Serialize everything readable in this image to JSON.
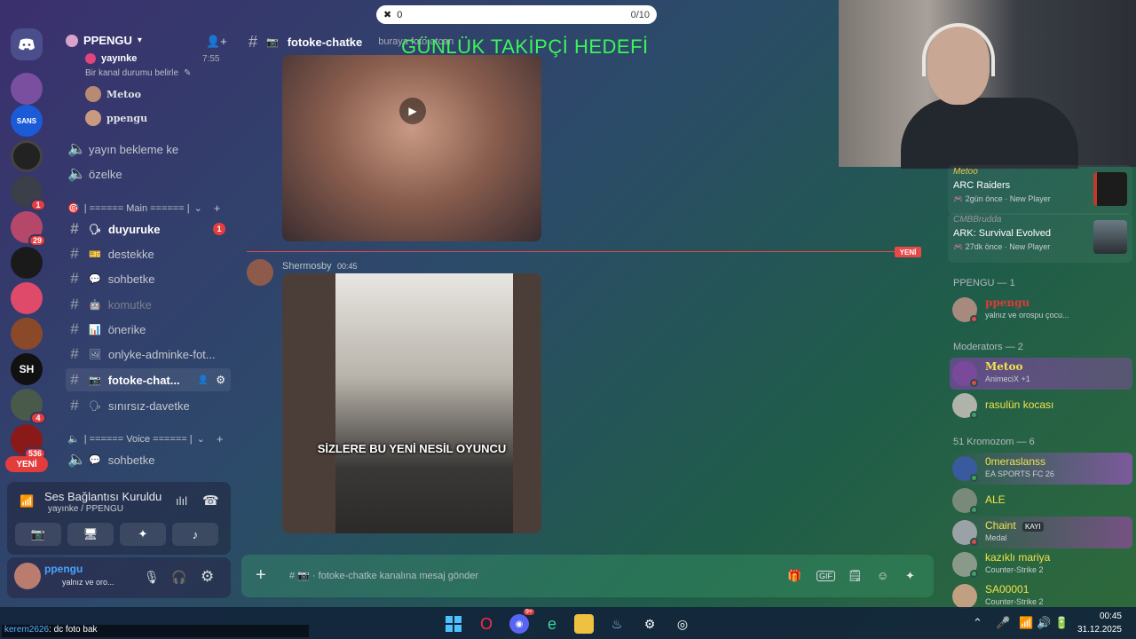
{
  "goal": {
    "current": "0",
    "count": "0/10",
    "title": "GÜNLÜK TAKİPÇİ HEDEFİ"
  },
  "server": {
    "name": "PPENGU"
  },
  "rail": {
    "badges": [
      "1",
      "29",
      "4",
      "536"
    ],
    "new_label": "YENİ"
  },
  "voice_top": {
    "user": "yayınke",
    "status": "Bir kanal durumu belirle",
    "time": "7:55",
    "members": [
      "Metoo",
      "ppengu"
    ]
  },
  "channels": {
    "voice_top": [
      "yayın bekleme ke",
      "özelke"
    ],
    "main_category": "| ====== Main ====== |",
    "text": [
      {
        "name": "duyuruke",
        "badge": "1"
      },
      {
        "name": "destekke"
      },
      {
        "name": "sohbetke"
      },
      {
        "name": "komutke"
      },
      {
        "name": "önerike"
      },
      {
        "name": "onlyke-adminke-fot..."
      },
      {
        "name": "fotoke-chat..."
      },
      {
        "name": "sınırsız-davetke"
      }
    ],
    "voice_category": "| ====== Voice ====== |",
    "voice": [
      "sohbetke"
    ]
  },
  "voice_panel": {
    "status": "Ses Bağlantısı Kuruldu",
    "sub": "yayınke / PPENGU"
  },
  "user_panel": {
    "name": "ppengu",
    "status": "yalnız ve oro..."
  },
  "header": {
    "channel": "fotoke-chatke",
    "topic": "buraya foto atcan"
  },
  "messages": {
    "author": "Shermosby",
    "time": "00:45",
    "caption": "SİZLERE BU YENİ NESİL OYUNCU",
    "new_tag": "YENİ"
  },
  "composer": {
    "placeholder": "fotoke-chatke kanalına mesaj gönder"
  },
  "members": {
    "activities": [
      {
        "who": "Metoo",
        "game": "ARC Raiders",
        "ago": "2gün önce",
        "tag": "New Player",
        "color": "#c0392b"
      },
      {
        "who": "CMBBrudda",
        "game": "ARK: Survival Evolved",
        "ago": "27dk önce",
        "tag": "New Player",
        "color": "#5a6a74"
      }
    ],
    "group_ppengu": "PPENGU — 1",
    "ppengu": {
      "name": "ppengu",
      "status": "yalnız ve orospu çocu..."
    },
    "group_mods": "Moderators — 2",
    "mods": [
      {
        "name": "Metoo",
        "status": "AnimeciX +1"
      },
      {
        "name": "rasulün kocası",
        "status": ""
      }
    ],
    "group_kromozom": "51 Kromozom — 6",
    "kromozom": [
      {
        "name": "0meraslanss",
        "status": "EA SPORTS FC 26"
      },
      {
        "name": "ALE",
        "status": ""
      },
      {
        "name": "Chaint",
        "status": "Medal",
        "tag": "KAYI"
      },
      {
        "name": "kazıklı mariya",
        "status": "Counter-Strike 2"
      },
      {
        "name": "SA00001",
        "status": "Counter-Strike 2"
      }
    ]
  },
  "taskbar": {
    "chat_user": "kerem2626",
    "chat_msg": ": dc foto bak",
    "time": "00:45",
    "date": "31.12.2025",
    "discord_badge": "9+"
  }
}
